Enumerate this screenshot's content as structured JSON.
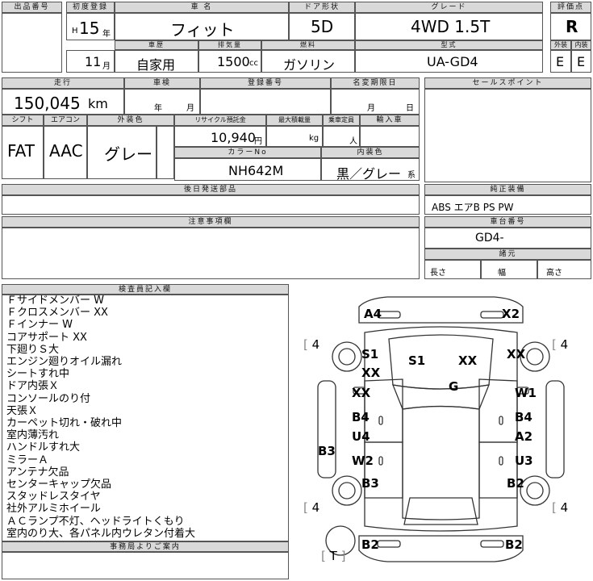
{
  "header": {
    "lot_label": "出品番号",
    "lot_value": "",
    "first_reg_label": "初度登録",
    "era": "H",
    "year": "15",
    "year_unit": "年",
    "month": "11",
    "month_unit": "月",
    "name_label": "車 名",
    "name_value": "フィット",
    "door_label": "ドア形状",
    "door_value": "5D",
    "grade_label": "グレード",
    "grade_value": "4WD 1.5T",
    "score_label": "評価点",
    "score_value": "R",
    "history_label": "車歴",
    "history_value": "自家用",
    "displacement_label": "排気量",
    "displacement_value": "1500",
    "displacement_unit": "cc",
    "fuel_label": "燃料",
    "fuel_value": "ガソリン",
    "model_label": "型式",
    "model_value": "UA-GD4",
    "ext_label": "外装",
    "ext_value": "E",
    "int_label": "内装",
    "int_value": "E"
  },
  "row2": {
    "mileage_label": "走行",
    "mileage_value": "150,045",
    "mileage_unit": "km",
    "inspection_label": "車検",
    "inspection_year": "年",
    "inspection_month": "月",
    "reg_no_label": "登録番号",
    "name_change_label": "名変期限日",
    "name_change_month": "月",
    "name_change_day": "日",
    "sales_point_label": "セールスポイント"
  },
  "row3": {
    "shift_label": "シフト",
    "shift_value": "FAT",
    "ac_label": "エアコン",
    "ac_value": "AAC",
    "color_label": "外装色",
    "color_value": "グレー",
    "recycle_label": "リサイクル預託金",
    "recycle_value": "10,940",
    "recycle_unit": "円",
    "load_label": "最大積載量",
    "load_unit": "kg",
    "capacity_label": "乗車定員",
    "capacity_unit": "人",
    "import_label": "輸入車",
    "color_no_label": "カラーNo",
    "color_no_value": "NH642M",
    "interior_label": "内装色",
    "interior_value": "黒／グレー",
    "interior_unit": "系"
  },
  "parts": {
    "later_label": "後日発送部品",
    "equip_label": "純正装備",
    "equip_value": "ABS エアB PS PW",
    "notes_label": "注意事項欄",
    "chassis_label": "車台番号",
    "chassis_value": "GD4-",
    "spec_label": "諸元",
    "length_label": "長さ",
    "width_label": "幅",
    "height_label": "高さ"
  },
  "inspector": {
    "label": "検査員記入欄",
    "lines": [
      "Ｆサイドメンバー W",
      "Ｆクロスメンバー XX",
      "Ｆインナー W",
      "コアサポート XX",
      "下廻りＳ大",
      "エンジン廻りオイル漏れ",
      "シートすれ中",
      "ドア内張Ｘ",
      "コンソールのり付",
      "天張Ｘ",
      "カーペット切れ・破れ中",
      "室内薄汚れ",
      "ハンドルすれ大",
      "ミラーＡ",
      "アンテナ欠品",
      "センターキャップ欠品",
      "スタッドレスタイヤ",
      "社外アルミホイール",
      "ＡＣランプ不灯、ヘッドライトくもり",
      "室内のり大、各パネル内ウレタン付着大"
    ],
    "office_label": "事務局よりご案内"
  },
  "diagram": {
    "front_bumper_left": "A4",
    "front_bumper_right": "X2",
    "tire_fl": "4",
    "tire_fr": "4",
    "tire_rl": "4",
    "tire_rr": "4",
    "tire_spare": "T",
    "fender_left_a": "S1",
    "fender_left_b": "XX",
    "fender_right": "XX",
    "hood_left": "S1",
    "hood_right": "XX",
    "windshield": "G",
    "roof_left": "XX",
    "pillar_right": "W1",
    "door_fl": "B4",
    "door_fr": "B4",
    "door_rl_a": "U4",
    "door_rl_b": "W2",
    "door_rr_a": "A2",
    "door_rr_b": "U3",
    "sill_left": "B3",
    "rear_fender_left": "B3",
    "rear_fender_right": "B2",
    "rear_bumper_left": "B2",
    "rear_bumper_right": "B2"
  }
}
